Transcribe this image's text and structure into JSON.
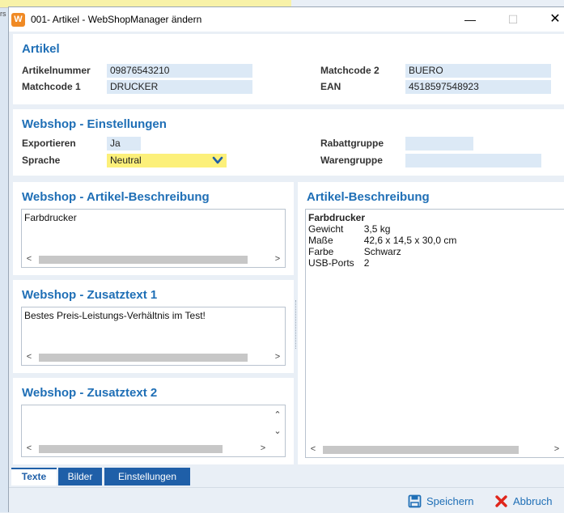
{
  "window": {
    "title": "001- Artikel - WebShopManager ändern",
    "app_icon": "wsm-icon",
    "controls": [
      "—",
      "☐",
      "✕"
    ]
  },
  "artikel": {
    "title": "Artikel",
    "artikelnummer_label": "Artikelnummer",
    "artikelnummer": "09876543210",
    "matchcode1_label": "Matchcode 1",
    "matchcode1": "DRUCKER",
    "matchcode2_label": "Matchcode 2",
    "matchcode2": "BUERO",
    "ean_label": "EAN",
    "ean": "4518597548923"
  },
  "webshop_settings": {
    "title": "Webshop - Einstellungen",
    "exportieren_label": "Exportieren",
    "exportieren": "Ja",
    "sprache_label": "Sprache",
    "sprache": "Neutral",
    "rabattgruppe_label": "Rabattgruppe",
    "rabattgruppe": "",
    "warengruppe_label": "Warengruppe",
    "warengruppe": ""
  },
  "ws_beschreibung": {
    "title": "Webshop - Artikel-Beschreibung",
    "text": "Farbdrucker"
  },
  "ws_zusatz1": {
    "title": "Webshop - Zusatztext 1",
    "text": "Bestes Preis-Leistungs-Verhältnis im Test!"
  },
  "ws_zusatz2": {
    "title": "Webshop - Zusatztext 2",
    "text": ""
  },
  "artikel_beschreibung": {
    "title": "Artikel-Beschreibung",
    "heading": "Farbdrucker",
    "rows": [
      {
        "key": "Gewicht",
        "value": "3,5 kg"
      },
      {
        "key": "Maße",
        "value": "42,6 x 14,5 x 30,0 cm"
      },
      {
        "key": "Farbe",
        "value": "Schwarz"
      },
      {
        "key": "USB-Ports",
        "value": "2"
      }
    ]
  },
  "tabs": [
    "Texte",
    "Bilder",
    "Einstellungen"
  ],
  "actions": {
    "save": "Speichern",
    "cancel": "Abbruch"
  },
  "colors": {
    "accent": "#1f6fb6",
    "tab_bg": "#1f5fa8",
    "field_bg": "#dce9f6",
    "highlight": "#fcf07a",
    "cancel": "#e0261b"
  }
}
